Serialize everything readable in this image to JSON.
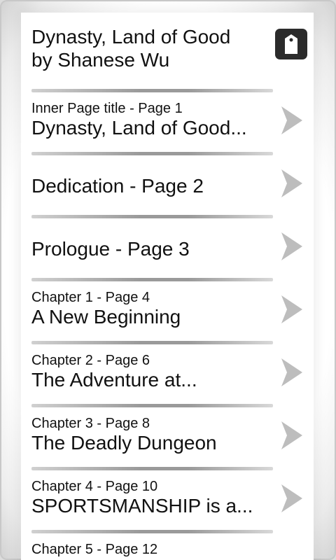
{
  "header": {
    "title_line1": "Dynasty, Land of Good",
    "title_line2": "by Shanese Wu"
  },
  "entries": [
    {
      "sub": " Inner Page title - Page 1",
      "main": "Dynasty, Land of Good..."
    },
    {
      "sub": "",
      "main": "Dedication - Page 2"
    },
    {
      "sub": "",
      "main": "Prologue - Page 3"
    },
    {
      "sub": "Chapter 1 - Page 4",
      "main": "A New Beginning"
    },
    {
      "sub": "Chapter 2 - Page 6",
      "main": "The Adventure at..."
    },
    {
      "sub": "Chapter 3 - Page 8",
      "main": "The Deadly Dungeon"
    },
    {
      "sub": "Chapter 4 - Page 10",
      "main": "SPORTSMANSHIP is a..."
    },
    {
      "sub": "Chapter 5 - Page 12",
      "main": ""
    }
  ]
}
